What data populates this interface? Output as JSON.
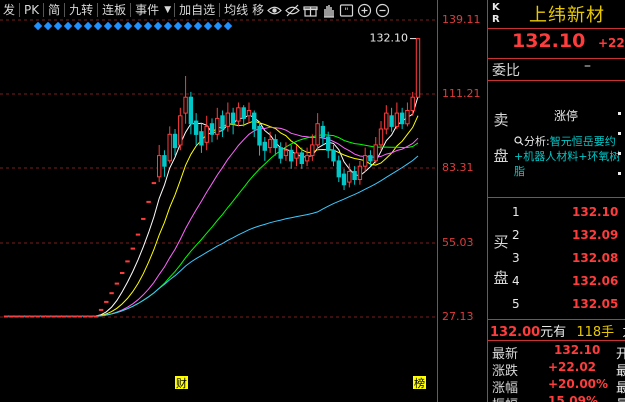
{
  "toolbar": {
    "items": [
      "发",
      "PK",
      "简",
      "九转",
      "连板",
      "事件"
    ],
    "items2": [
      "加自选",
      "均线",
      "移"
    ],
    "icons": [
      "eye-icon",
      "eye-slash-icon",
      "gift-icon",
      "hand-icon",
      "quote-icon",
      "zoom-in-icon",
      "zoom-out-icon"
    ]
  },
  "axis": {
    "labels": [
      "139.11",
      "111.21",
      "83.31",
      "55.03",
      "27.13"
    ],
    "values": [
      139.11,
      111.21,
      83.31,
      55.03,
      27.13
    ]
  },
  "chart": {
    "current_price_label": "132.10",
    "markers": {
      "cai": "财",
      "bang": "榜"
    },
    "colors": {
      "up": "#ff3c3c",
      "down": "#00c8c8",
      "ma5": "#ffffff",
      "ma10": "#ffff00",
      "ma20": "#ff66ff",
      "ma30": "#00ff00",
      "ma60": "#3ccaff"
    }
  },
  "quote": {
    "code": [
      "K",
      "R"
    ],
    "name": "上纬新材",
    "price": "132.10",
    "change": "+22.",
    "weibi_label": "委比",
    "weibi_value": "–",
    "sell_label": [
      "卖",
      "盘"
    ],
    "zhangting": "涨停",
    "analysis_prefix": "分析:",
    "analysis_text": "智元恒岳要约+机器人材料+环氧树脂",
    "buy_label": [
      "买",
      "盘"
    ],
    "buy_levels": [
      {
        "level": "1",
        "price": "132.10"
      },
      {
        "level": "2",
        "price": "132.09"
      },
      {
        "level": "3",
        "price": "132.08"
      },
      {
        "level": "4",
        "price": "132.06"
      },
      {
        "level": "5",
        "price": "132.05"
      }
    ],
    "last_trade": {
      "price": "132.00",
      "unit": "元有",
      "volume": "118手",
      "tail": "力"
    },
    "stats": [
      {
        "label": "最新",
        "value": "132.10",
        "tail": "开"
      },
      {
        "label": "涨跌",
        "value": "+22.02",
        "tail": "最"
      },
      {
        "label": "涨幅",
        "value": "+20.00%",
        "tail": "最"
      },
      {
        "label": "振幅",
        "value": "15.09%",
        "tail": "量"
      }
    ]
  }
}
